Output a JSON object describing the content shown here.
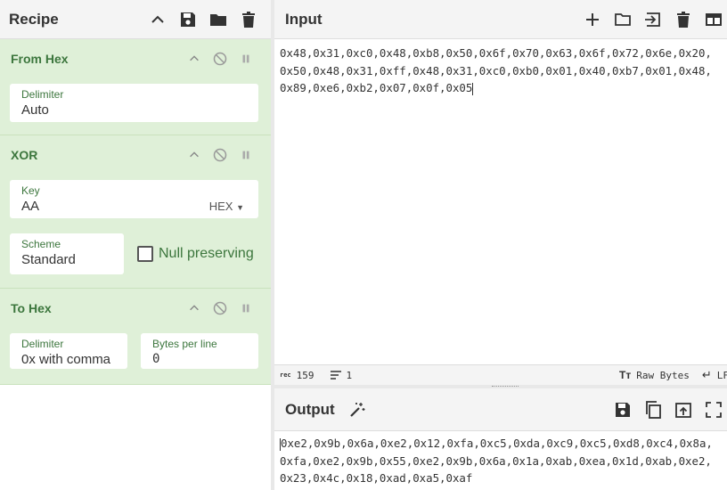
{
  "recipe": {
    "title": "Recipe",
    "operations": [
      {
        "name": "From Hex",
        "fields": [
          {
            "label": "Delimiter",
            "value": "Auto"
          }
        ]
      },
      {
        "name": "XOR",
        "key": {
          "label": "Key",
          "value": "AA",
          "format": "HEX"
        },
        "scheme": {
          "label": "Scheme",
          "value": "Standard"
        },
        "null_preserving": {
          "label": "Null preserving",
          "checked": false
        }
      },
      {
        "name": "To Hex",
        "delimiter": {
          "label": "Delimiter",
          "value": "0x with comma"
        },
        "bytes_per_line": {
          "label": "Bytes per line",
          "value": "0"
        }
      }
    ]
  },
  "input": {
    "title": "Input",
    "lines": [
      "0x48,0x31,0xc0,0x48,0xb8,0x50,0x6f,0x70,0x63,0x6f,0x72,0x6e,0x20,",
      "0x50,0x48,0x31,0xff,0x48,0x31,0xc0,0xb0,0x01,0x40,0xb7,0x01,0x48,",
      "0x89,0xe6,0xb2,0x07,0x0f,0x05"
    ],
    "status": {
      "length_label": "rec",
      "length": "159",
      "lines_count": "1",
      "encoding": "Raw Bytes",
      "eol": "LF"
    }
  },
  "output": {
    "title": "Output",
    "lines": [
      "0xe2,0x9b,0x6a,0xe2,0x12,0xfa,0xc5,0xda,0xc9,0xc5,0xd8,0xc4,0x8a,",
      "0xfa,0xe2,0x9b,0x55,0xe2,0x9b,0x6a,0x1a,0xab,0xea,0x1d,0xab,0xe2,",
      "0x23,0x4c,0x18,0xad,0xa5,0xaf"
    ]
  },
  "icons": {
    "recipe": [
      "chevron-up-icon",
      "save-icon",
      "folder-icon",
      "trash-icon"
    ],
    "operation": [
      "chevron-up-icon",
      "disable-icon",
      "pause-icon"
    ],
    "input": [
      "plus-icon",
      "folder-icon",
      "import-icon",
      "trash-icon",
      "layout-icon"
    ],
    "output": [
      "magic-wand-icon",
      "save-icon",
      "copy-icon",
      "replace-input-icon",
      "maximise-icon"
    ]
  },
  "colors": {
    "op_bg": "#dff0d8",
    "op_text": "#3c763d",
    "header_bg": "#f4f4f4"
  }
}
